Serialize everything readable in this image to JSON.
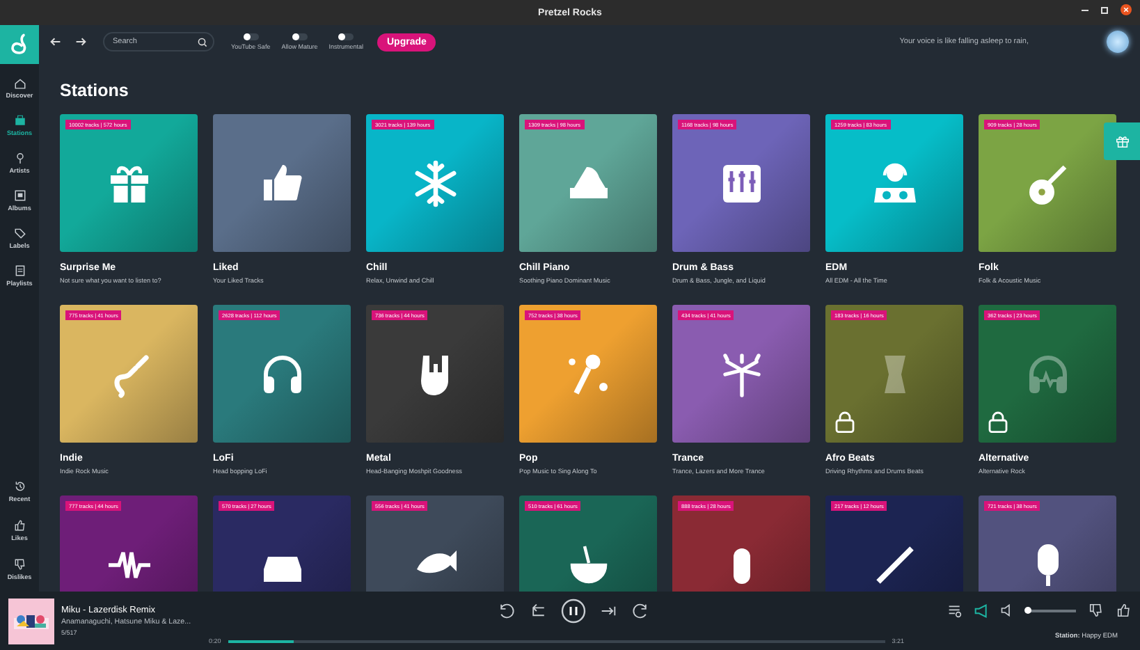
{
  "window": {
    "title": "Pretzel Rocks"
  },
  "sidebar": {
    "items": [
      {
        "label": "Discover",
        "selected": false
      },
      {
        "label": "Stations",
        "selected": true
      },
      {
        "label": "Artists",
        "selected": false
      },
      {
        "label": "Albums",
        "selected": false
      },
      {
        "label": "Labels",
        "selected": false
      },
      {
        "label": "Playlists",
        "selected": false
      }
    ],
    "bottom_items": [
      {
        "label": "Recent",
        "selected": false
      },
      {
        "label": "Likes",
        "selected": false
      },
      {
        "label": "Dislikes",
        "selected": false
      }
    ]
  },
  "toolbar": {
    "search": {
      "placeholder": "Search"
    },
    "toggles": [
      {
        "label": "YouTube Safe",
        "on": false
      },
      {
        "label": "Allow Mature",
        "on": false
      },
      {
        "label": "Instrumental",
        "on": false
      }
    ],
    "upgrade": "Upgrade",
    "greeting": "Your voice is like falling asleep to rain,"
  },
  "page_title": "Stations",
  "stations": [
    {
      "name": "Surprise Me",
      "description": "Not sure what you want to listen to?",
      "badge": "10002 tracks | 572 hours",
      "locked": false,
      "color": "#12a99a"
    },
    {
      "name": "Liked",
      "description": "Your Liked Tracks",
      "locked": false,
      "color": "#5a6e8a"
    },
    {
      "name": "Chill",
      "description": "Relax, Unwind and Chill",
      "badge": "3021 tracks | 139 hours",
      "locked": false,
      "color": "#08b5c8"
    },
    {
      "name": "Chill Piano",
      "description": "Soothing Piano Dominant Music",
      "badge": "1309 tracks | 98 hours",
      "locked": false,
      "color": "#5fa698"
    },
    {
      "name": "Drum & Bass",
      "description": "Drum & Bass, Jungle, and Liquid",
      "badge": "1168 tracks | 98 hours",
      "locked": false,
      "color": "#6d64b8"
    },
    {
      "name": "EDM",
      "description": "All EDM - All the Time",
      "badge": "1259 tracks | 83 hours",
      "locked": false,
      "color": "#06bdc8"
    },
    {
      "name": "Folk",
      "description": "Folk & Acoustic Music",
      "badge": "909 tracks | 28 hours",
      "locked": false,
      "color": "#7ca444"
    },
    {
      "name": "Indie",
      "description": "Indie Rock Music",
      "badge": "775 tracks | 41 hours",
      "locked": false,
      "color": "#dab660"
    },
    {
      "name": "LoFi",
      "description": "Head bopping LoFi",
      "badge": "2628 tracks | 112 hours",
      "locked": false,
      "color": "#2a7a7c"
    },
    {
      "name": "Metal",
      "description": "Head-Banging Moshpit Goodness",
      "badge": "736 tracks | 44 hours",
      "locked": false,
      "color": "#3a3a3a"
    },
    {
      "name": "Pop",
      "description": "Pop Music to Sing Along To",
      "badge": "752 tracks | 38 hours",
      "locked": false,
      "color": "#eea030"
    },
    {
      "name": "Trance",
      "description": "Trance, Lazers and More Trance",
      "badge": "434 tracks | 41 hours",
      "locked": false,
      "color": "#8a5cb0"
    },
    {
      "name": "Afro Beats",
      "description": "Driving Rhythms and Drums Beats",
      "badge": "183 tracks | 16 hours",
      "locked": true,
      "color": "#6a7030"
    },
    {
      "name": "Alternative",
      "description": "Alternative Rock",
      "badge": "362 tracks | 23 hours",
      "locked": true,
      "color": "#1f6a40"
    },
    {
      "badge": "777 tracks | 44 hours",
      "locked": false,
      "color": "#6e1e78"
    },
    {
      "badge": "570 tracks | 27 hours",
      "locked": false,
      "color": "#2a2a62"
    },
    {
      "badge": "556 tracks | 41 hours",
      "locked": false,
      "color": "#3e4a5a"
    },
    {
      "badge": "510 tracks | 61 hours",
      "locked": false,
      "color": "#1a6656"
    },
    {
      "badge": "888 tracks | 28 hours",
      "locked": false,
      "color": "#8a2a34"
    },
    {
      "badge": "217 tracks | 12 hours",
      "locked": false,
      "color": "#1c2452"
    },
    {
      "badge": "721 tracks | 38 hours",
      "locked": false,
      "color": "#52527e"
    }
  ],
  "player": {
    "title": "Miku - Lazerdisk Remix",
    "artist": "Anamanaguchi, Hatsune Miku & Laze...",
    "position": "5/517",
    "elapsed": "0:20",
    "duration": "3:21",
    "level": 0.1,
    "volume": {
      "level": 0.05
    },
    "station": "**Station:** Happy EDM"
  }
}
